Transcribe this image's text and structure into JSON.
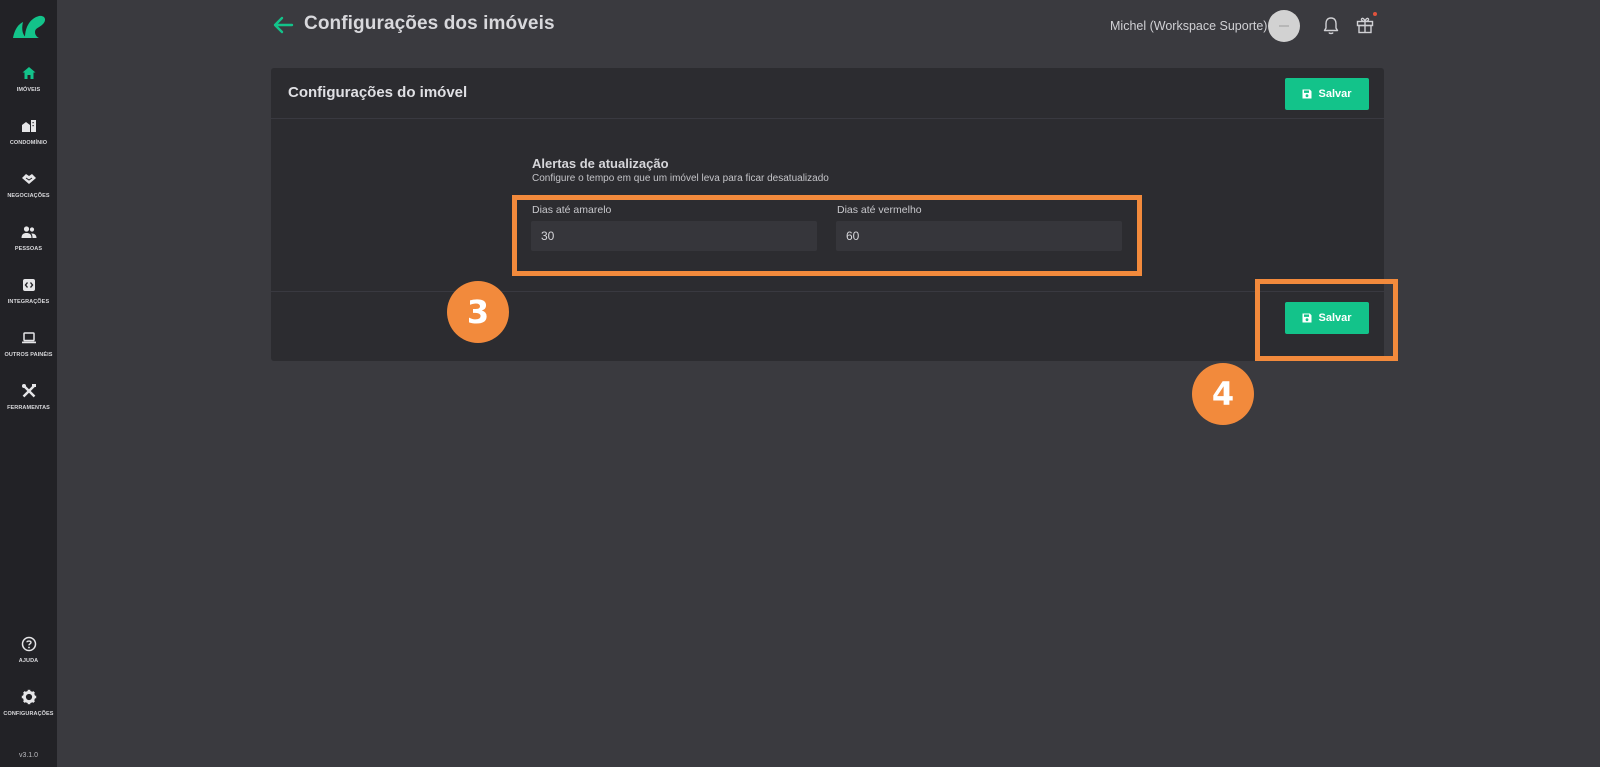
{
  "sidebar": {
    "items": [
      {
        "label": "IMÓVEIS",
        "icon": "home-icon",
        "active": true
      },
      {
        "label": "CONDOMÍNIO",
        "icon": "building-icon"
      },
      {
        "label": "NEGOCIAÇÕES",
        "icon": "handshake-icon"
      },
      {
        "label": "PESSOAS",
        "icon": "people-icon"
      },
      {
        "label": "INTEGRAÇÕES",
        "icon": "integration-icon"
      },
      {
        "label": "OUTROS PAINÉIS",
        "icon": "laptop-icon"
      },
      {
        "label": "FERRAMENTAS",
        "icon": "tools-icon"
      }
    ],
    "bottom_items": [
      {
        "label": "AJUDA",
        "icon": "help-icon"
      },
      {
        "label": "CONFIGURAÇÕES",
        "icon": "gear-icon"
      }
    ],
    "version": "v3.1.0"
  },
  "header": {
    "title": "Configurações dos imóveis",
    "user_name": "Michel (Workspace Suporte)"
  },
  "card": {
    "title": "Configurações do imóvel",
    "save_label": "Salvar",
    "section_title": "Alertas de atualização",
    "section_description": "Configure o tempo em que um imóvel leva para ficar desatualizado",
    "fields": [
      {
        "label": "Dias até amarelo",
        "value": "30"
      },
      {
        "label": "Dias até vermelho",
        "value": "60"
      }
    ]
  },
  "annotations": {
    "step_fields": "3",
    "step_save": "4"
  },
  "colors": {
    "accent": "#13c38a",
    "annotation": "#f28a3c",
    "background": "#3a3a3f",
    "sidebar": "#222226",
    "card": "#2c2c30"
  }
}
